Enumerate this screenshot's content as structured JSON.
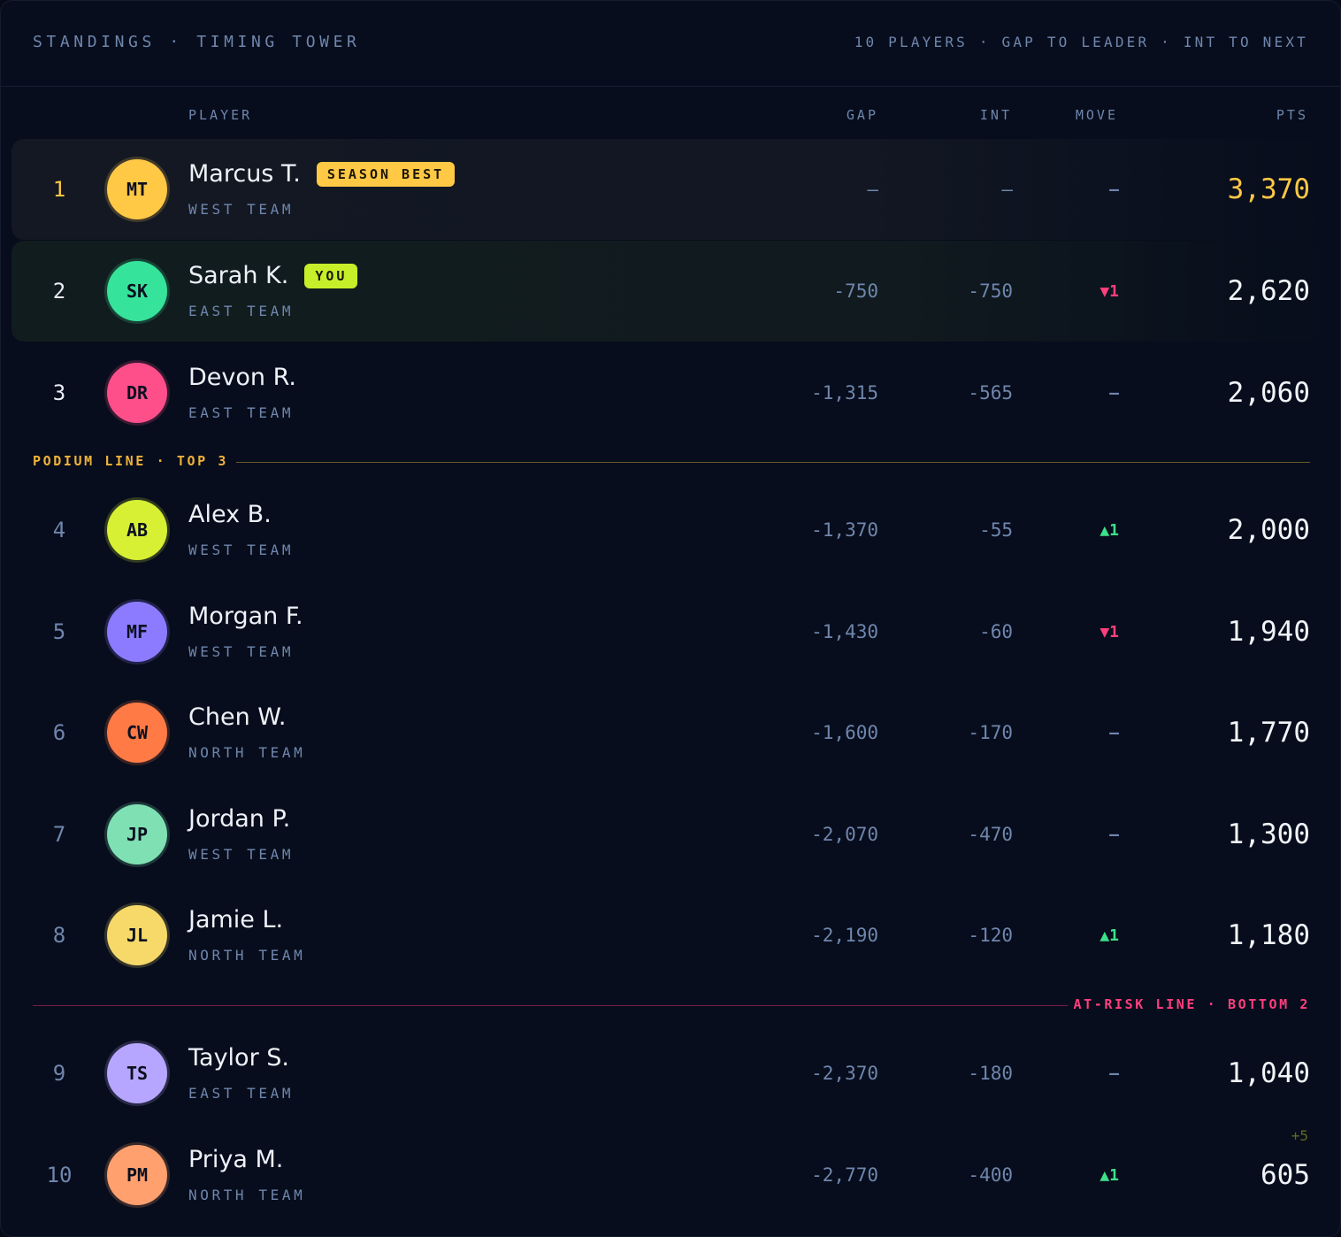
{
  "header": {
    "title": "STANDINGS · TIMING TOWER",
    "meta": "10 PLAYERS · GAP TO LEADER · INT TO NEXT"
  },
  "columns": {
    "player": "PLAYER",
    "gap": "GAP",
    "int": "INT",
    "move": "MOVE",
    "pts": "PTS"
  },
  "colors": {
    "gold": "#ffc845",
    "up": "#3ee08a",
    "down": "#ff3f7e",
    "muted": "#6f86ad",
    "you_badge": "#c6ef2a",
    "season_best_badge": "#ffc845"
  },
  "rows": [
    {
      "pos": "1",
      "initials": "MT",
      "name": "Marcus T.",
      "team": "WEST TEAM",
      "gap": "—",
      "int": "—",
      "move": "—",
      "move_dir": "none",
      "pts": "3,370",
      "badge": "SEASON BEST",
      "avatar_color": "#ffc845"
    },
    {
      "pos": "2",
      "initials": "SK",
      "name": "Sarah K.",
      "team": "EAST TEAM",
      "gap": "-750",
      "int": "-750",
      "move": "▼1",
      "move_dir": "down",
      "pts": "2,620",
      "badge": "YOU",
      "avatar_color": "#36e39a"
    },
    {
      "pos": "3",
      "initials": "DR",
      "name": "Devon R.",
      "team": "EAST TEAM",
      "gap": "-1,315",
      "int": "-565",
      "move": "—",
      "move_dir": "none",
      "pts": "2,060",
      "badge": "",
      "avatar_color": "#ff4f8b"
    },
    {
      "pos": "4",
      "initials": "AB",
      "name": "Alex B.",
      "team": "WEST TEAM",
      "gap": "-1,370",
      "int": "-55",
      "move": "▲1",
      "move_dir": "up",
      "pts": "2,000",
      "badge": "",
      "avatar_color": "#d7f034"
    },
    {
      "pos": "5",
      "initials": "MF",
      "name": "Morgan F.",
      "team": "WEST TEAM",
      "gap": "-1,430",
      "int": "-60",
      "move": "▼1",
      "move_dir": "down",
      "pts": "1,940",
      "badge": "",
      "avatar_color": "#8d7bff"
    },
    {
      "pos": "6",
      "initials": "CW",
      "name": "Chen W.",
      "team": "NORTH TEAM",
      "gap": "-1,600",
      "int": "-170",
      "move": "—",
      "move_dir": "none",
      "pts": "1,770",
      "badge": "",
      "avatar_color": "#ff7a45"
    },
    {
      "pos": "7",
      "initials": "JP",
      "name": "Jordan P.",
      "team": "WEST TEAM",
      "gap": "-2,070",
      "int": "-470",
      "move": "—",
      "move_dir": "none",
      "pts": "1,300",
      "badge": "",
      "avatar_color": "#7fe0b4"
    },
    {
      "pos": "8",
      "initials": "JL",
      "name": "Jamie L.",
      "team": "NORTH TEAM",
      "gap": "-2,190",
      "int": "-120",
      "move": "▲1",
      "move_dir": "up",
      "pts": "1,180",
      "badge": "",
      "avatar_color": "#f7d96a"
    },
    {
      "pos": "9",
      "initials": "TS",
      "name": "Taylor S.",
      "team": "EAST TEAM",
      "gap": "-2,370",
      "int": "-180",
      "move": "—",
      "move_dir": "none",
      "pts": "1,040",
      "badge": "",
      "avatar_color": "#b7a6ff"
    },
    {
      "pos": "10",
      "initials": "PM",
      "name": "Priya M.",
      "team": "NORTH TEAM",
      "gap": "-2,770",
      "int": "-400",
      "move": "▲1",
      "move_dir": "up",
      "pts": "605",
      "badge": "",
      "avatar_color": "#ffa06e"
    }
  ],
  "podium_line": {
    "label": "PODIUM LINE · TOP 3"
  },
  "risk_line": {
    "label": "AT-RISK LINE · BOTTOM 2"
  },
  "last_row_delta": "+5"
}
